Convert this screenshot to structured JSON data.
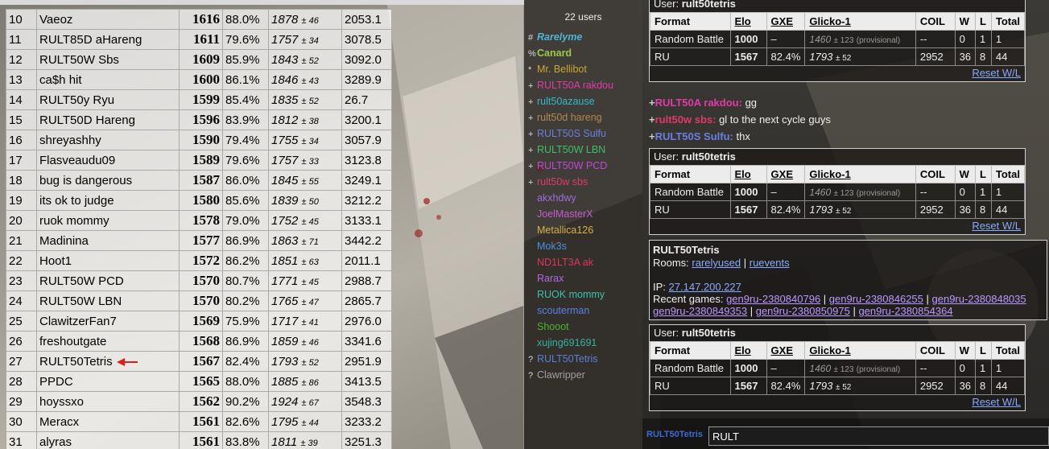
{
  "ladder": {
    "rows": [
      {
        "rank": "10",
        "name": "Vaeoz",
        "elo": "1616",
        "gxe": "88.0%",
        "glicko": "1878",
        "dev": "± 46",
        "coil": "2053.1"
      },
      {
        "rank": "11",
        "name": "RULT85D aHareng",
        "elo": "1611",
        "gxe": "79.6%",
        "glicko": "1757",
        "dev": "± 34",
        "coil": "3078.5"
      },
      {
        "rank": "12",
        "name": "RULT50W Sbs",
        "elo": "1609",
        "gxe": "85.9%",
        "glicko": "1843",
        "dev": "± 52",
        "coil": "3092.0"
      },
      {
        "rank": "13",
        "name": "ca$h hit",
        "elo": "1600",
        "gxe": "86.1%",
        "glicko": "1846",
        "dev": "± 43",
        "coil": "3289.9"
      },
      {
        "rank": "14",
        "name": "RULT50y Ryu",
        "elo": "1599",
        "gxe": "85.4%",
        "glicko": "1835",
        "dev": "± 52",
        "coil": "26.7"
      },
      {
        "rank": "15",
        "name": "RULT50D Hareng",
        "elo": "1596",
        "gxe": "83.9%",
        "glicko": "1812",
        "dev": "± 38",
        "coil": "3200.1"
      },
      {
        "rank": "16",
        "name": "shreyashhy",
        "elo": "1590",
        "gxe": "79.4%",
        "glicko": "1755",
        "dev": "± 34",
        "coil": "3057.9"
      },
      {
        "rank": "17",
        "name": "Flasveaudu09",
        "elo": "1589",
        "gxe": "79.6%",
        "glicko": "1757",
        "dev": "± 33",
        "coil": "3123.8"
      },
      {
        "rank": "18",
        "name": "bug is dangerous",
        "elo": "1587",
        "gxe": "86.0%",
        "glicko": "1845",
        "dev": "± 55",
        "coil": "3249.1"
      },
      {
        "rank": "19",
        "name": "its ok to judge",
        "elo": "1580",
        "gxe": "85.6%",
        "glicko": "1839",
        "dev": "± 50",
        "coil": "3212.2"
      },
      {
        "rank": "20",
        "name": "ruok mommy",
        "elo": "1578",
        "gxe": "79.0%",
        "glicko": "1752",
        "dev": "± 45",
        "coil": "3133.1"
      },
      {
        "rank": "21",
        "name": "Madinina",
        "elo": "1577",
        "gxe": "86.9%",
        "glicko": "1863",
        "dev": "± 71",
        "coil": "3442.2"
      },
      {
        "rank": "22",
        "name": "Hoot1",
        "elo": "1572",
        "gxe": "86.2%",
        "glicko": "1851",
        "dev": "± 63",
        "coil": "2011.1"
      },
      {
        "rank": "23",
        "name": "RULT50W PCD",
        "elo": "1570",
        "gxe": "80.7%",
        "glicko": "1771",
        "dev": "± 45",
        "coil": "2988.7"
      },
      {
        "rank": "24",
        "name": "RULT50W LBN",
        "elo": "1570",
        "gxe": "80.2%",
        "glicko": "1765",
        "dev": "± 47",
        "coil": "2865.7"
      },
      {
        "rank": "25",
        "name": "ClawitzerFan7",
        "elo": "1569",
        "gxe": "75.9%",
        "glicko": "1717",
        "dev": "± 41",
        "coil": "2976.0"
      },
      {
        "rank": "26",
        "name": "freshoutgate",
        "elo": "1568",
        "gxe": "86.9%",
        "glicko": "1859",
        "dev": "± 46",
        "coil": "3341.6"
      },
      {
        "rank": "27",
        "name": "RULT50Tetris",
        "elo": "1567",
        "gxe": "82.4%",
        "glicko": "1793",
        "dev": "± 52",
        "coil": "2951.9",
        "marked": true
      },
      {
        "rank": "28",
        "name": "PPDC",
        "elo": "1565",
        "gxe": "88.0%",
        "glicko": "1885",
        "dev": "± 86",
        "coil": "3413.5"
      },
      {
        "rank": "29",
        "name": "hoyssxo",
        "elo": "1562",
        "gxe": "90.2%",
        "glicko": "1924",
        "dev": "± 67",
        "coil": "3548.3"
      },
      {
        "rank": "30",
        "name": "Meracx",
        "elo": "1561",
        "gxe": "82.6%",
        "glicko": "1795",
        "dev": "± 44",
        "coil": "3233.2"
      },
      {
        "rank": "31",
        "name": "alyras",
        "elo": "1561",
        "gxe": "83.8%",
        "glicko": "1811",
        "dev": "± 39",
        "coil": "3251.3"
      }
    ]
  },
  "userlist": {
    "count_label": "22 users",
    "users": [
      {
        "group": "#",
        "name": "Rarelyme",
        "color": "#4fb3d4",
        "style": "bi"
      },
      {
        "group": "%",
        "name": "Canard",
        "color": "#9bc94a",
        "style": "b"
      },
      {
        "group": "*",
        "name": "Mr. Bellibot",
        "color": "#c9a632",
        "style": ""
      },
      {
        "group": "+",
        "name": "RULT50A rakdou",
        "color": "#e13ba6",
        "style": ""
      },
      {
        "group": "+",
        "name": "rult50azause",
        "color": "#33b9c8",
        "style": ""
      },
      {
        "group": "+",
        "name": "rult50d hareng",
        "color": "#b08a4a",
        "style": ""
      },
      {
        "group": "+",
        "name": "RULT50S Sulfu",
        "color": "#6a7fe0",
        "style": ""
      },
      {
        "group": "+",
        "name": "RULT50W LBN",
        "color": "#3fbf66",
        "style": ""
      },
      {
        "group": "+",
        "name": "RULT50W PCD",
        "color": "#c048d6",
        "style": ""
      },
      {
        "group": "+",
        "name": "rult50w sbs",
        "color": "#e03a6a",
        "style": ""
      },
      {
        "group": "",
        "name": "akxhdwy",
        "color": "#a06cd6",
        "style": ""
      },
      {
        "group": "",
        "name": "JoelMasterX",
        "color": "#c75ad0",
        "style": ""
      },
      {
        "group": "",
        "name": "Metallica126",
        "color": "#d6b04a",
        "style": ""
      },
      {
        "group": "",
        "name": "Mok3s",
        "color": "#4c8fe0",
        "style": ""
      },
      {
        "group": "",
        "name": "ND1LT3A ak",
        "color": "#e0345a",
        "style": ""
      },
      {
        "group": "",
        "name": "Rarax",
        "color": "#b066e6",
        "style": ""
      },
      {
        "group": "",
        "name": "RUOK mommy",
        "color": "#39c2a8",
        "style": ""
      },
      {
        "group": "",
        "name": "scouterman",
        "color": "#5a80e6",
        "style": ""
      },
      {
        "group": "",
        "name": "Shooot",
        "color": "#4ab32e",
        "style": ""
      },
      {
        "group": "",
        "name": "xujing691691",
        "color": "#35b2a0",
        "style": ""
      },
      {
        "group": "?",
        "name": "RULT50Tetris",
        "color": "#5a7fd6",
        "style": ""
      },
      {
        "group": "?",
        "name": "Clawripper",
        "color": "#a0a0a0",
        "style": ""
      }
    ]
  },
  "chat": {
    "user_label": "User:",
    "username": "rult50tetris",
    "headers": [
      "Format",
      "Elo",
      "GXE",
      "Glicko-1",
      "COIL",
      "W",
      "L",
      "Total"
    ],
    "rows": [
      {
        "format": "Random Battle",
        "elo": "1000",
        "gxe": "–",
        "glicko": "1460",
        "dev": "± 123",
        "prov": "(provisional)",
        "coil": "--",
        "w": "0",
        "l": "1",
        "total": "1"
      },
      {
        "format": "RU",
        "elo": "1567",
        "gxe": "82.4%",
        "glicko": "1793",
        "dev": "± 52",
        "coil": "2952",
        "w": "36",
        "l": "8",
        "total": "44"
      }
    ],
    "reset_label": "Reset W/L",
    "messages": [
      {
        "rank": "+",
        "name": "RULT50A rakdou:",
        "color": "#e13ba6",
        "text": "gg"
      },
      {
        "rank": "+",
        "name": "rult50w sbs:",
        "color": "#e03a6a",
        "text": "gl to the next cycle guys"
      },
      {
        "rank": "+",
        "name": "RULT50S Sulfu:",
        "color": "#6a7fe0",
        "text": "thx"
      }
    ],
    "info": {
      "title": "RULT50Tetris",
      "rooms_label": "Rooms:",
      "rooms": [
        "rarelyused",
        "ruevents"
      ],
      "ip_label": "IP:",
      "ip": "27.147.200.227",
      "recent_label": "Recent games:",
      "games": [
        "gen9ru-2380840796",
        "gen9ru-2380846255",
        "gen9ru-2380848035",
        "gen9ru-2380849353",
        "gen9ru-2380850975",
        "gen9ru-2380854364"
      ]
    },
    "input_user": "RULT50Tetris",
    "input_value": "RULT"
  }
}
